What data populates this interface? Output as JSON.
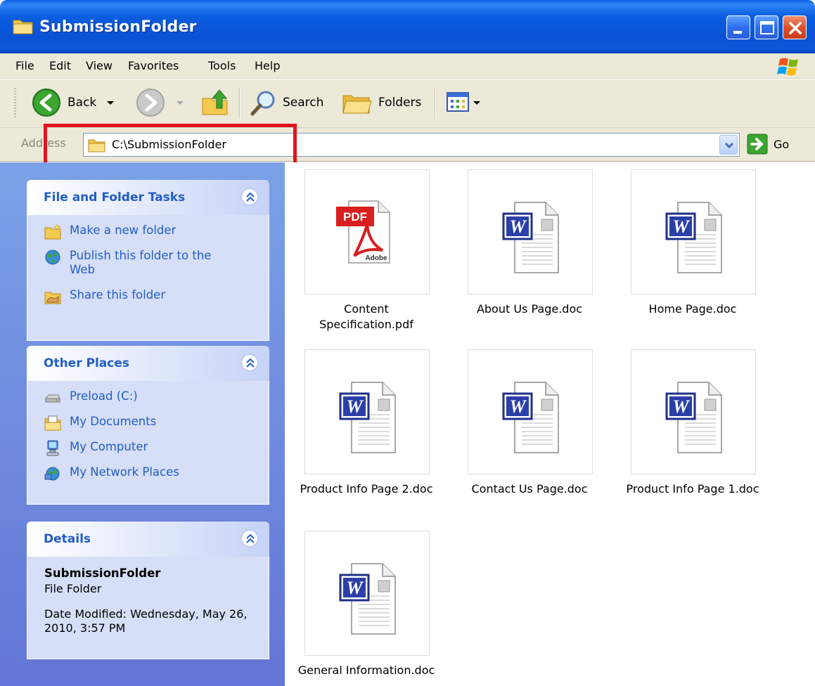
{
  "window": {
    "title": "SubmissionFolder"
  },
  "menu": {
    "items": [
      "File",
      "Edit",
      "View",
      "Favorites",
      "Tools",
      "Help"
    ]
  },
  "toolbar": {
    "back_label": "Back",
    "search_label": "Search",
    "folders_label": "Folders"
  },
  "address": {
    "label": "Address",
    "value": "C:\\SubmissionFolder",
    "go_label": "Go"
  },
  "tasks": {
    "title": "File and Folder Tasks",
    "items": [
      "Make a new folder",
      "Publish this folder to the Web",
      "Share this folder"
    ]
  },
  "other_places": {
    "title": "Other Places",
    "items": [
      "Preload (C:)",
      "My Documents",
      "My Computer",
      "My Network Places"
    ]
  },
  "details": {
    "title": "Details",
    "name": "SubmissionFolder",
    "type": "File Folder",
    "date": "Date Modified: Wednesday, May 26, 2010, 3:57 PM"
  },
  "files": [
    {
      "name": "Content Specification.pdf",
      "kind": "pdf"
    },
    {
      "name": "About Us Page.doc",
      "kind": "doc"
    },
    {
      "name": "Home Page.doc",
      "kind": "doc"
    },
    {
      "name": "Product Info Page 2.doc",
      "kind": "doc"
    },
    {
      "name": "Contact Us Page.doc",
      "kind": "doc"
    },
    {
      "name": "Product Info Page 1.doc",
      "kind": "doc"
    },
    {
      "name": "General Information.doc",
      "kind": "doc"
    }
  ],
  "colors": {
    "accent": "#215dc6",
    "titlebar": "#0a5fe0",
    "highlight": "#e0141e"
  }
}
